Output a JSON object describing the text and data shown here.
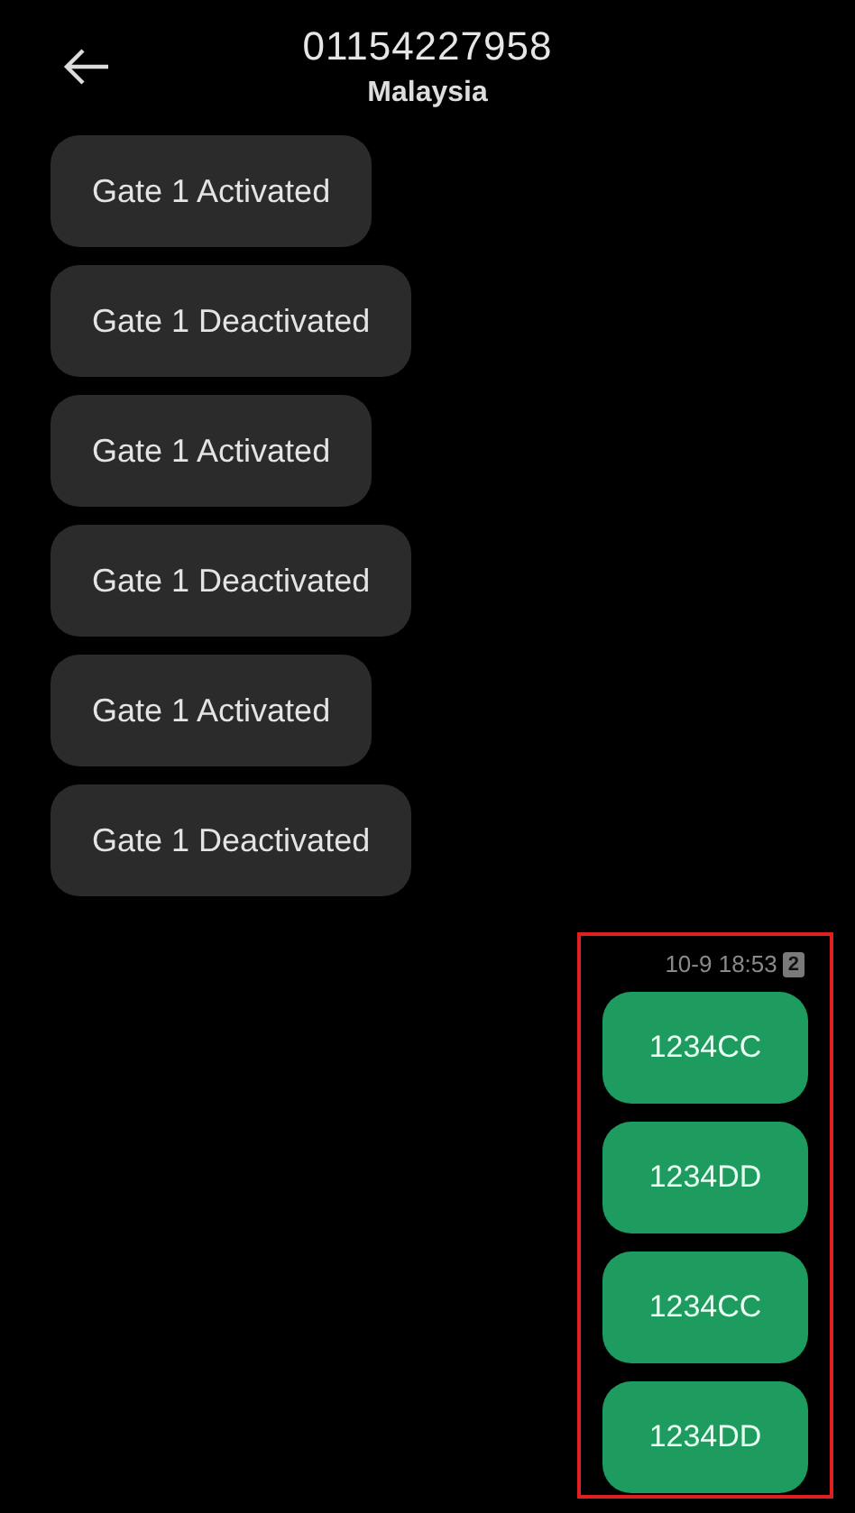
{
  "header": {
    "title": "01154227958",
    "subtitle": "Malaysia"
  },
  "incoming": [
    {
      "text": "Gate 1 Activated"
    },
    {
      "text": "Gate 1 Deactivated"
    },
    {
      "text": "Gate 1 Activated"
    },
    {
      "text": "Gate 1 Deactivated"
    },
    {
      "text": "Gate 1 Activated"
    },
    {
      "text": "Gate 1 Deactivated"
    }
  ],
  "outgoing": {
    "highlighted": true,
    "timestamp": "10-9 18:53",
    "sim": "2",
    "messages": [
      {
        "text": "1234CC"
      },
      {
        "text": "1234DD"
      },
      {
        "text": "1234CC"
      },
      {
        "text": "1234DD"
      }
    ]
  }
}
